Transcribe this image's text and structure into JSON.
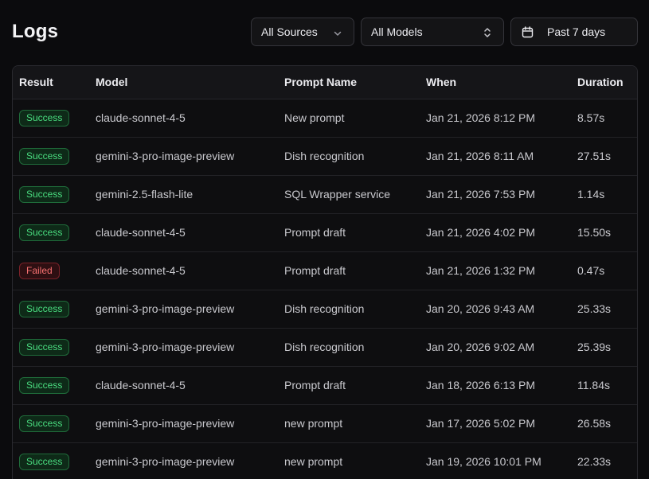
{
  "header": {
    "title": "Logs"
  },
  "filters": {
    "source": {
      "value": "All Sources",
      "icon": "chevron-down-icon"
    },
    "model": {
      "value": "All Models",
      "icon": "chevron-up-down-icon"
    },
    "date": {
      "value": "Past 7 days",
      "icon": "calendar-icon"
    }
  },
  "table": {
    "columns": [
      "Result",
      "Model",
      "Prompt Name",
      "When",
      "Duration"
    ],
    "rows": [
      {
        "result": "Success",
        "status": "success",
        "model": "claude-sonnet-4-5",
        "prompt": "New prompt",
        "when": "Jan 21, 2026 8:12 PM",
        "duration": "8.57s"
      },
      {
        "result": "Success",
        "status": "success",
        "model": "gemini-3-pro-image-preview",
        "prompt": "Dish recognition",
        "when": "Jan 21, 2026 8:11 AM",
        "duration": "27.51s"
      },
      {
        "result": "Success",
        "status": "success",
        "model": "gemini-2.5-flash-lite",
        "prompt": "SQL Wrapper service",
        "when": "Jan 21, 2026 7:53 PM",
        "duration": "1.14s"
      },
      {
        "result": "Success",
        "status": "success",
        "model": "claude-sonnet-4-5",
        "prompt": "Prompt draft",
        "when": "Jan 21, 2026 4:02 PM",
        "duration": "15.50s"
      },
      {
        "result": "Failed",
        "status": "failed",
        "model": "claude-sonnet-4-5",
        "prompt": "Prompt draft",
        "when": "Jan 21, 2026 1:32 PM",
        "duration": "0.47s"
      },
      {
        "result": "Success",
        "status": "success",
        "model": "gemini-3-pro-image-preview",
        "prompt": "Dish recognition",
        "when": "Jan 20, 2026 9:43 AM",
        "duration": "25.33s"
      },
      {
        "result": "Success",
        "status": "success",
        "model": "gemini-3-pro-image-preview",
        "prompt": "Dish recognition",
        "when": "Jan 20, 2026 9:02 AM",
        "duration": "25.39s"
      },
      {
        "result": "Success",
        "status": "success",
        "model": "claude-sonnet-4-5",
        "prompt": "Prompt draft",
        "when": "Jan 18, 2026 6:13 PM",
        "duration": "11.84s"
      },
      {
        "result": "Success",
        "status": "success",
        "model": "gemini-3-pro-image-preview",
        "prompt": "new prompt",
        "when": "Jan 17, 2026 5:02 PM",
        "duration": "26.58s"
      },
      {
        "result": "Success",
        "status": "success",
        "model": "gemini-3-pro-image-preview",
        "prompt": "new prompt",
        "when": "Jan 19, 2026 10:01 PM",
        "duration": "22.33s"
      }
    ]
  },
  "colors": {
    "success": "#4ade80",
    "failed": "#f87171",
    "background": "#0b0b0d"
  }
}
